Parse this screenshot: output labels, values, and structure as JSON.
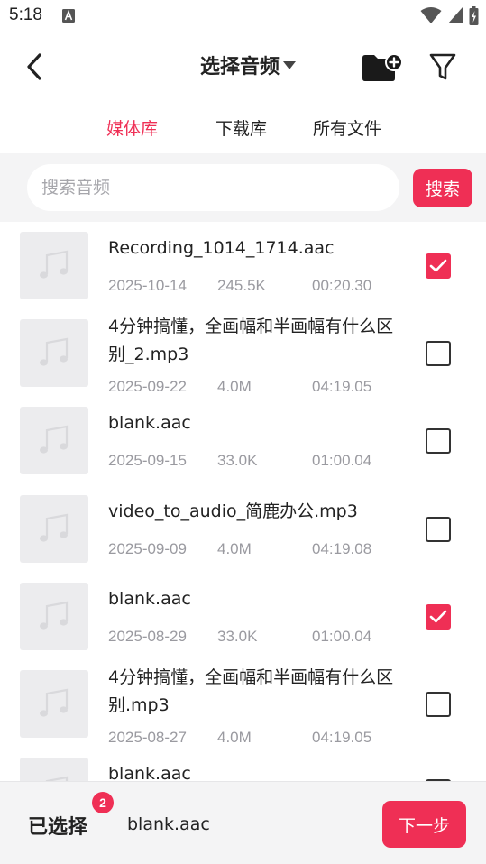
{
  "status_bar": {
    "time": "5:18"
  },
  "header": {
    "title": "选择音频"
  },
  "tabs": [
    {
      "label": "媒体库",
      "active": true
    },
    {
      "label": "下载库",
      "active": false
    },
    {
      "label": "所有文件",
      "active": false
    }
  ],
  "search": {
    "placeholder": "搜索音频",
    "value": "",
    "button_label": "搜索"
  },
  "files": [
    {
      "name": "Recording_1014_1714.aac",
      "date": "2025-10-14",
      "size": "245.5K",
      "duration": "00:20.30",
      "checked": true
    },
    {
      "name": "4分钟搞懂，全画幅和半画幅有什么区别_2.mp3",
      "date": "2025-09-22",
      "size": "4.0M",
      "duration": "04:19.05",
      "checked": false
    },
    {
      "name": "blank.aac",
      "date": "2025-09-15",
      "size": "33.0K",
      "duration": "01:00.04",
      "checked": false
    },
    {
      "name": "video_to_audio_简鹿办公.mp3",
      "date": "2025-09-09",
      "size": "4.0M",
      "duration": "04:19.08",
      "checked": false
    },
    {
      "name": "blank.aac",
      "date": "2025-08-29",
      "size": "33.0K",
      "duration": "01:00.04",
      "checked": true
    },
    {
      "name": "4分钟搞懂，全画幅和半画幅有什么区别.mp3",
      "date": "2025-08-27",
      "size": "4.0M",
      "duration": "04:19.05",
      "checked": false
    },
    {
      "name": "blank.aac",
      "date": "",
      "size": "",
      "duration": "",
      "checked": false
    }
  ],
  "bottom_bar": {
    "selected_label": "已选择",
    "selected_count": "2",
    "selected_file": "blank.aac",
    "next_label": "下一步"
  },
  "colors": {
    "accent": "#ef2f55",
    "thumb_bg": "#ececee",
    "bar_bg": "#f4f4f5"
  },
  "icons": [
    "back-arrow-icon",
    "dropdown-caret-icon",
    "add-folder-icon",
    "filter-icon",
    "music-note-icon",
    "checkmark-icon",
    "wifi-icon",
    "signal-icon",
    "battery-icon",
    "notification-icon"
  ]
}
